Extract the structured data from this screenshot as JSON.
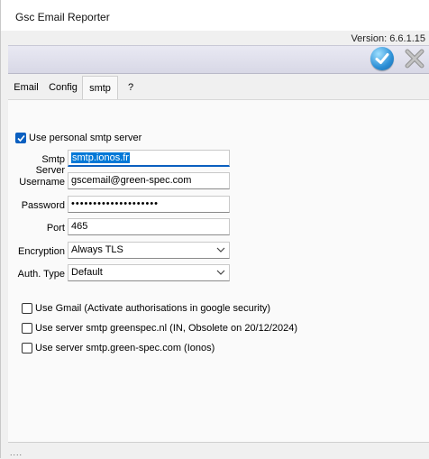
{
  "window": {
    "title": "Gsc Email Reporter",
    "version": "Version: 6.6.1.15"
  },
  "toolbar": {
    "ok_icon": "check-icon",
    "cancel_icon": "close-icon"
  },
  "tabs": [
    {
      "label": "Email"
    },
    {
      "label": "Config"
    },
    {
      "label": "smtp",
      "active": true
    },
    {
      "label": "?"
    }
  ],
  "smtp": {
    "use_personal": {
      "label": "Use personal smtp server",
      "checked": true
    },
    "server": {
      "label": "Smtp Server",
      "value": "smtp.ionos.fr"
    },
    "username": {
      "label": "Username",
      "value": "gscemail@green-spec.com"
    },
    "password": {
      "label": "Password",
      "value": "••••••••••••••••••••"
    },
    "port": {
      "label": "Port",
      "value": "465"
    },
    "encryption": {
      "label": "Encryption",
      "value": "Always TLS"
    },
    "auth_type": {
      "label": "Auth. Type",
      "value": "Default"
    },
    "options": [
      {
        "label": "Use Gmail (Activate authorisations in google security)",
        "checked": false
      },
      {
        "label": "Use server smtp greenspec.nl (IN, Obsolete on 20/12/2024)",
        "checked": false
      },
      {
        "label": "Use server smtp.green-spec.com (Ionos)",
        "checked": false
      }
    ]
  },
  "statusbar": {
    "grip": "...."
  },
  "colors": {
    "accent": "#0a5fc0",
    "selection": "#0078d7",
    "toolbar": "#dcdce8"
  }
}
